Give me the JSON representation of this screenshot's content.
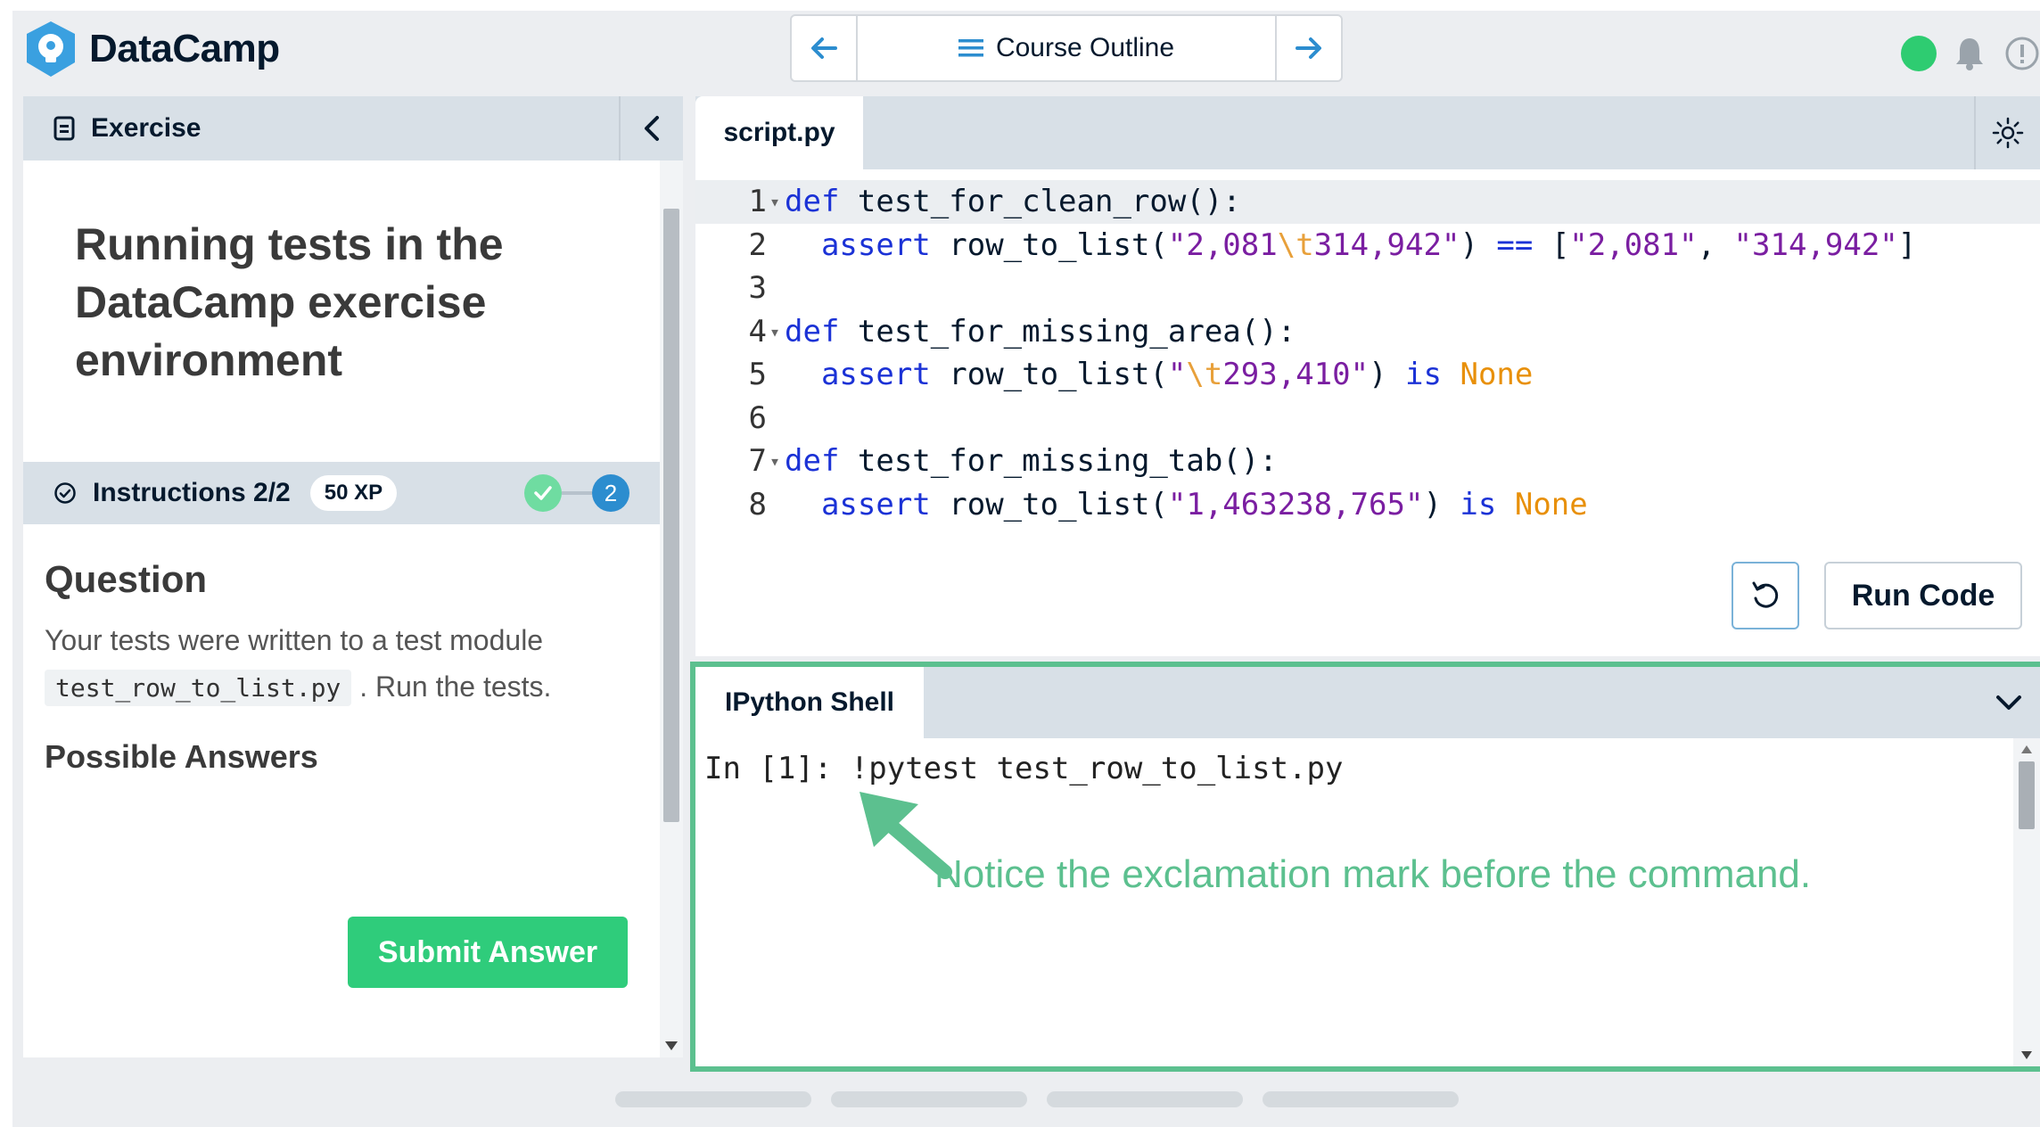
{
  "app": {
    "name": "DataCamp"
  },
  "header": {
    "outline_label": "Course Outline",
    "status_color": "#2ecc71"
  },
  "exercise": {
    "panel_title": "Exercise",
    "heading": "Running tests in the DataCamp exercise environment",
    "instructions_label": "Instructions 2/2",
    "xp_badge": "50 XP",
    "current_step": "2",
    "question_title": "Question",
    "question_text_pre": "Your tests were written to a test module",
    "question_code": "test_row_to_list.py",
    "question_text_post": ". Run the tests.",
    "possible_answers_title": "Possible Answers",
    "submit_label": "Submit Answer"
  },
  "editor": {
    "tab_label": "script.py",
    "run_label": "Run Code",
    "lines": [
      {
        "n": "1",
        "code": "def test_for_clean_row():"
      },
      {
        "n": "2",
        "code": "  assert row_to_list(\"2,081\\t314,942\") == [\"2,081\", \"314,942\"]"
      },
      {
        "n": "3",
        "code": ""
      },
      {
        "n": "4",
        "code": "def test_for_missing_area():"
      },
      {
        "n": "5",
        "code": "  assert row_to_list(\"\\t293,410\") is None"
      },
      {
        "n": "6",
        "code": ""
      },
      {
        "n": "7",
        "code": "def test_for_missing_tab():"
      },
      {
        "n": "8",
        "code": "  assert row_to_list(\"1,463238,765\") is None"
      }
    ]
  },
  "shell": {
    "tab_label": "IPython Shell",
    "prompt": "In [1]:",
    "command": "!pytest test_row_to_list.py",
    "annotation": "Notice the exclamation mark before the command.",
    "annotation_color": "#5cc08f"
  },
  "colors": {
    "accent_green": "#2fcc7b",
    "step_blue": "#2c8dcf",
    "keyword": "#1b32d6",
    "string": "#7a1ea1",
    "constant": "#e8900a"
  }
}
